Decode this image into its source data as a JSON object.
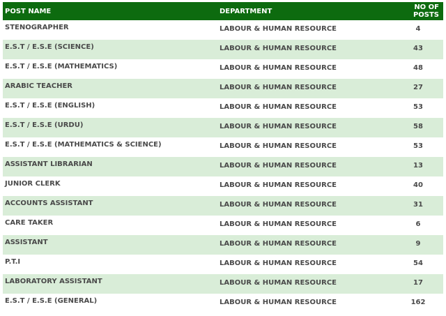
{
  "table": {
    "headers": {
      "post_name": "POST NAME",
      "department": "DEPARTMENT",
      "no_of_posts": "NO OF POSTS"
    },
    "rows": [
      {
        "post": "STENOGRAPHER",
        "department": "LABOUR & HUMAN RESOURCE",
        "posts": "4"
      },
      {
        "post": "E.S.T / E.S.E (SCIENCE)",
        "department": "LABOUR & HUMAN RESOURCE",
        "posts": "43"
      },
      {
        "post": "E.S.T / E.S.E (MATHEMATICS)",
        "department": "LABOUR & HUMAN RESOURCE",
        "posts": "48"
      },
      {
        "post": "ARABIC TEACHER",
        "department": "LABOUR & HUMAN RESOURCE",
        "posts": "27"
      },
      {
        "post": "E.S.T / E.S.E (ENGLISH)",
        "department": "LABOUR & HUMAN RESOURCE",
        "posts": "53"
      },
      {
        "post": "E.S.T / E.S.E (URDU)",
        "department": "LABOUR & HUMAN RESOURCE",
        "posts": "58"
      },
      {
        "post": "E.S.T / E.S.E (MATHEMATICS & SCIENCE)",
        "department": "LABOUR & HUMAN RESOURCE",
        "posts": "53"
      },
      {
        "post": "ASSISTANT LIBRARIAN",
        "department": "LABOUR & HUMAN RESOURCE",
        "posts": "13"
      },
      {
        "post": "JUNIOR CLERK",
        "department": "LABOUR & HUMAN RESOURCE",
        "posts": "40"
      },
      {
        "post": "ACCOUNTS ASSISTANT",
        "department": "LABOUR & HUMAN RESOURCE",
        "posts": "31"
      },
      {
        "post": "CARE TAKER",
        "department": "LABOUR & HUMAN RESOURCE",
        "posts": "6"
      },
      {
        "post": "ASSISTANT",
        "department": "LABOUR & HUMAN RESOURCE",
        "posts": "9"
      },
      {
        "post": "P.T.I",
        "department": "LABOUR & HUMAN RESOURCE",
        "posts": "54"
      },
      {
        "post": "LABORATORY ASSISTANT",
        "department": "LABOUR & HUMAN RESOURCE",
        "posts": "17"
      },
      {
        "post": "E.S.T / E.S.E (GENERAL)",
        "department": "LABOUR & HUMAN RESOURCE",
        "posts": "162"
      }
    ]
  },
  "colors": {
    "header_bg": "#0d6b0f",
    "header_text": "#ffffff",
    "stripe_bg": "#d9edd8",
    "body_text": "#4a4a4a"
  }
}
